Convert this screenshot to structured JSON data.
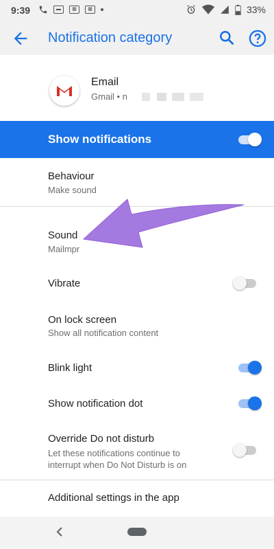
{
  "status_bar": {
    "time": "9:39",
    "left_icons": [
      "call-icon",
      "message-icon",
      "gallery-icon",
      "gallery-icon",
      "dot-icon"
    ],
    "battery": "33%",
    "right_icons": [
      "alarm-icon",
      "wifi-icon",
      "signal-icon",
      "battery-icon"
    ]
  },
  "toolbar": {
    "title": "Notification category",
    "back_icon": "arrow-back-icon",
    "search_icon": "search-icon",
    "help_icon": "help-icon"
  },
  "app": {
    "name": "Email",
    "subtitle": "Gmail • n",
    "icon": "gmail-icon"
  },
  "master_toggle": {
    "label": "Show notifications",
    "state": true
  },
  "settings": [
    {
      "title": "Behaviour",
      "subtitle": "Make sound"
    },
    {
      "title": "Sound",
      "subtitle": "Mailmpr"
    },
    {
      "title": "Vibrate",
      "toggle": false
    },
    {
      "title": "On lock screen",
      "subtitle": "Show all notification content"
    },
    {
      "title": "Blink light",
      "toggle": true
    },
    {
      "title": "Show notification dot",
      "toggle": true
    },
    {
      "title": "Override Do not disturb",
      "subtitle_line1": "Let these notifications continue to",
      "subtitle_line2": "interrupt when Do Not Disturb is on",
      "toggle": false
    },
    {
      "title": "Additional settings in the app"
    }
  ],
  "nav_bar": {
    "back_icon": "nav-back-icon",
    "home_icon": "nav-home-pill"
  },
  "colors": {
    "accent": "#1a73e8",
    "annotation_arrow": "#a57ae0"
  }
}
